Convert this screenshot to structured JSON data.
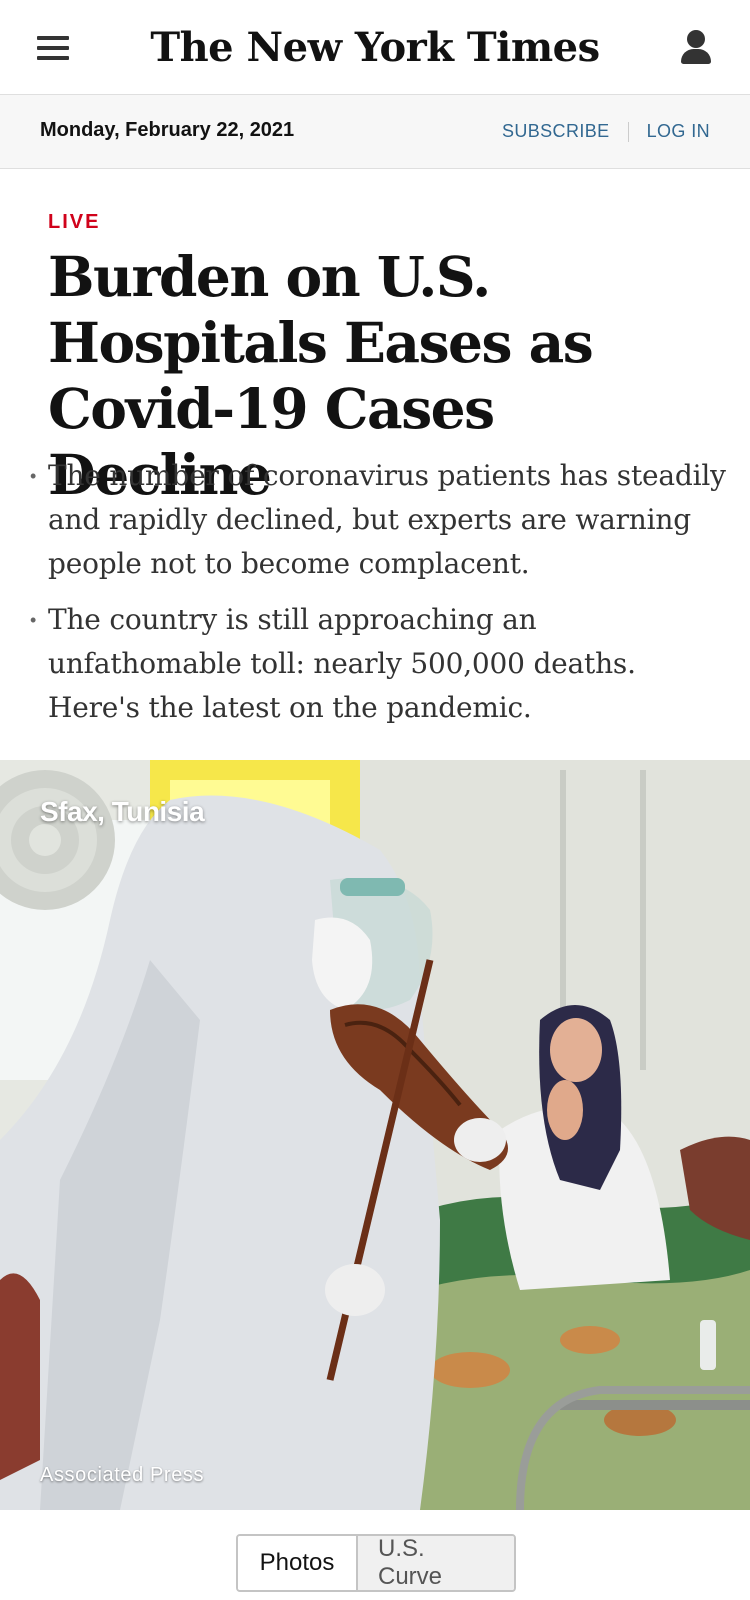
{
  "masthead": {
    "logo": "The New York Times",
    "menu_icon": "hamburger-menu-icon",
    "account_icon": "user-account-icon"
  },
  "datebar": {
    "date": "Monday, February 22, 2021",
    "subscribe": "SUBSCRIBE",
    "login": "LOG IN"
  },
  "article": {
    "kicker": "LIVE",
    "headline": "Burden on U.S. Hospitals Eases as Covid-19 Cases Decline",
    "summary": [
      "The number of coronavirus patients has steadily and rapidly declined, but experts are warning people not to become complacent.",
      "The country is still approaching an unfathomable toll: nearly 500,000 deaths. Here's the latest on the pandemic."
    ]
  },
  "photo": {
    "location": "Sfax, Tunisia",
    "credit": "Associated Press"
  },
  "toggle": {
    "options": [
      "Photos",
      "U.S. Curve"
    ],
    "selected": "Photos"
  },
  "colors": {
    "live_red": "#d0021b",
    "link_blue": "#326891",
    "datebar_bg": "#f7f7f7"
  }
}
